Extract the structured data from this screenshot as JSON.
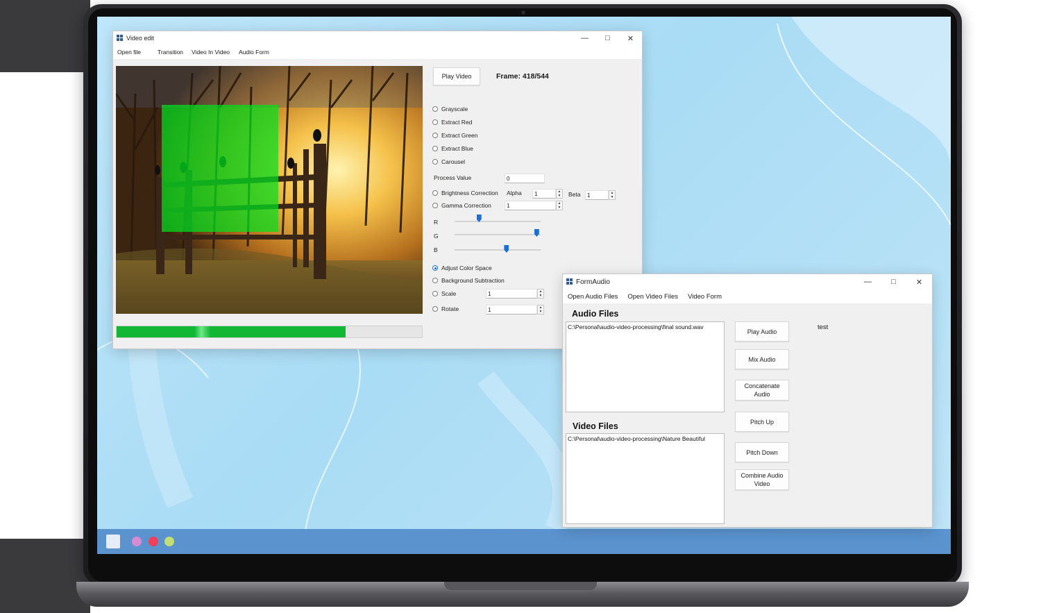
{
  "colors": {
    "accent": "#1c6ed4",
    "progress": "#12b734",
    "overlay_green": "#00e21e",
    "taskbar": "#5b93cf"
  },
  "taskbar": {
    "dots": [
      "#d98bd2",
      "#f0405a",
      "#c2de74"
    ]
  },
  "video_window": {
    "title": "Video edit",
    "menu": [
      "Open file",
      "Transition",
      "Video In Video",
      "Audio Form"
    ],
    "play_button": "Play Video",
    "frame_label": "Frame: 418/544",
    "progress": 0.75,
    "options": {
      "grayscale": "Grayscale",
      "extract_red": "Extract Red",
      "extract_green": "Extract Green",
      "extract_blue": "Extract Blue",
      "carousel": "Carousel",
      "brightness": "Brightness Correction",
      "gamma": "Gamma Correction",
      "adjust_color_space": "Adjust Color Space",
      "background_subtraction": "Background Subtraction",
      "scale": "Scale",
      "rotate": "Rotate"
    },
    "selected_option": "adjust_color_space",
    "process_value_label": "Process Value",
    "process_value": "0",
    "alpha_label": "Alpha",
    "alpha_value": "1",
    "beta_label": "Beta",
    "beta_value": "1",
    "gamma_value": "1",
    "scale_value": "1",
    "rotate_value": "1",
    "sliders": [
      {
        "label": "R",
        "value": 0.28
      },
      {
        "label": "G",
        "value": 0.95
      },
      {
        "label": "B",
        "value": 0.6
      }
    ]
  },
  "audio_window": {
    "title": "FormAudio",
    "menu": [
      "Open Audio Files",
      "Open Video Files",
      "Video Form"
    ],
    "audio_files_title": "Audio Files",
    "audio_files": [
      "C:\\Personal\\audio-video-processing\\final sound.wav"
    ],
    "video_files_title": "Video Files",
    "video_files": [
      "C:\\Personal\\audio-video-processing\\Nature Beautiful"
    ],
    "buttons": {
      "play_audio": "Play Audio",
      "mix_audio": "Mix Audio",
      "concatenate_audio": "Concatenate Audio",
      "pitch_up": "Pitch Up",
      "pitch_down": "Pitch Down",
      "combine_audio_video": "Combine Audio Video"
    },
    "status_text": "test"
  },
  "icons": {
    "minimize": "minimize-icon",
    "maximize": "maximize-icon",
    "close": "close-icon"
  }
}
